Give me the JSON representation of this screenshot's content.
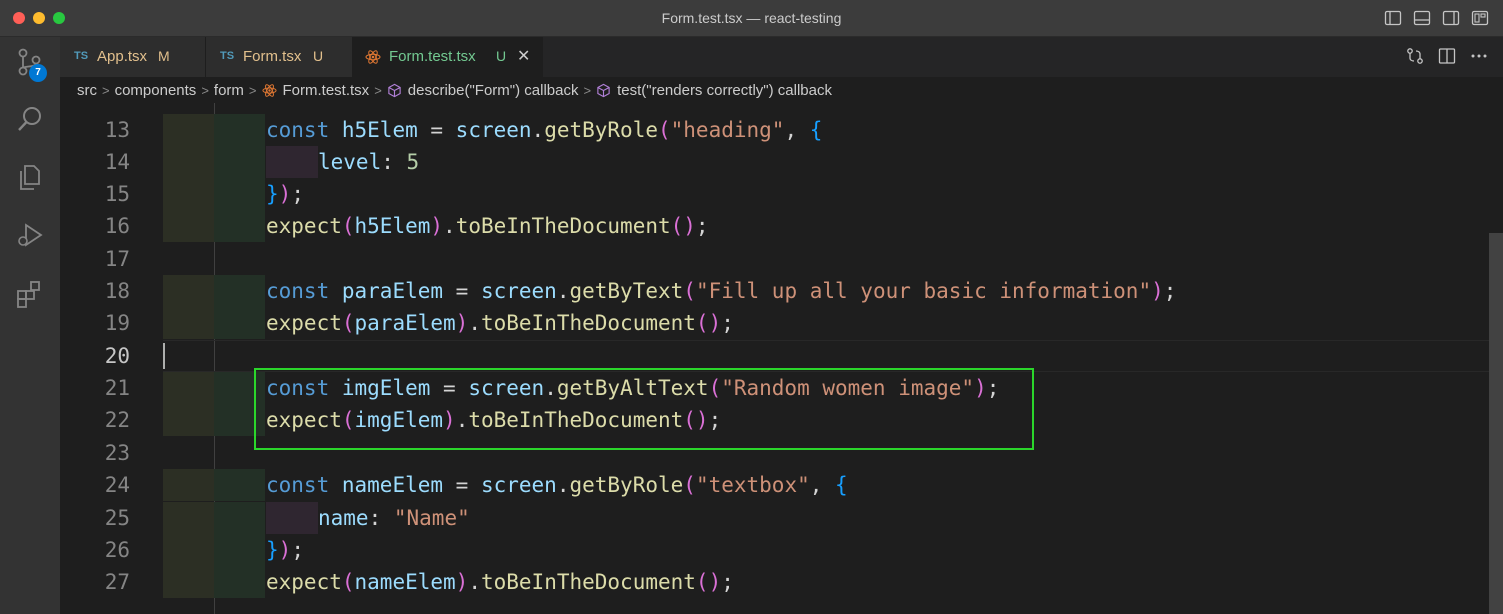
{
  "window": {
    "title": "Form.test.tsx — react-testing"
  },
  "activity": {
    "scm_badge": "7"
  },
  "tabs": [
    {
      "lang": "TS",
      "name": "App.tsx",
      "state": "M"
    },
    {
      "lang": "TS",
      "name": "Form.tsx",
      "state": "U"
    },
    {
      "lang": "",
      "name": "Form.test.tsx",
      "state": "U",
      "close": "✕"
    }
  ],
  "breadcrumb": {
    "items": [
      "src",
      "components",
      "form",
      "Form.test.tsx",
      "describe(\"Form\") callback",
      "test(\"renders correctly\") callback"
    ]
  },
  "editor": {
    "line_numbers": [
      "13",
      "14",
      "15",
      "16",
      "17",
      "18",
      "19",
      "20",
      "21",
      "22",
      "23",
      "24",
      "25",
      "26",
      "27"
    ],
    "current_line": "20"
  },
  "code": {
    "l13": {
      "kw": "const",
      "v1": "h5Elem",
      "eq": " = ",
      "obj": "screen",
      "dot": ".",
      "fn": "getByRole",
      "p1": "(",
      "s1": "\"heading\"",
      "c": ", ",
      "b": "{"
    },
    "l14": {
      "prop": "level",
      "colon": ": ",
      "num": "5"
    },
    "l15": {
      "b": "}",
      "p": ")",
      "semi": ";"
    },
    "l16": {
      "fn": "expect",
      "p1": "(",
      "v": "h5Elem",
      "p2": ")",
      "dot": ".",
      "fn2": "toBeInTheDocument",
      "p3": "()",
      "semi": ";"
    },
    "l18": {
      "kw": "const",
      "v1": "paraElem",
      "eq": " = ",
      "obj": "screen",
      "dot": ".",
      "fn": "getByText",
      "p1": "(",
      "s1": "\"Fill up all your basic information\"",
      "p2": ")",
      "semi": ";"
    },
    "l19": {
      "fn": "expect",
      "p1": "(",
      "v": "paraElem",
      "p2": ")",
      "dot": ".",
      "fn2": "toBeInTheDocument",
      "p3": "()",
      "semi": ";"
    },
    "l21": {
      "kw": "const",
      "v1": "imgElem",
      "eq": " = ",
      "obj": "screen",
      "dot": ".",
      "fn": "getByAltText",
      "p1": "(",
      "s1": "\"Random women image\"",
      "p2": ")",
      "semi": ";"
    },
    "l22": {
      "fn": "expect",
      "p1": "(",
      "v": "imgElem",
      "p2": ")",
      "dot": ".",
      "fn2": "toBeInTheDocument",
      "p3": "()",
      "semi": ";"
    },
    "l24": {
      "kw": "const",
      "v1": "nameElem",
      "eq": " = ",
      "obj": "screen",
      "dot": ".",
      "fn": "getByRole",
      "p1": "(",
      "s1": "\"textbox\"",
      "c": ", ",
      "b": "{"
    },
    "l25": {
      "prop": "name",
      "colon": ": ",
      "str": "\"Name\""
    },
    "l26": {
      "b": "}",
      "p": ")",
      "semi": ";"
    },
    "l27": {
      "fn": "expect",
      "p1": "(",
      "v": "nameElem",
      "p2": ")",
      "dot": ".",
      "fn2": "toBeInTheDocument",
      "p3": "()",
      "semi": ";"
    }
  },
  "colors": {
    "keyword": "#569cd6",
    "variable": "#9cdcfe",
    "function": "#dcdcaa",
    "string": "#ce9178",
    "number": "#b5cea8",
    "highlight_box": "#2bd62b",
    "modified": "#e2c08d",
    "untracked": "#73c991"
  },
  "icons": [
    "source-control-icon",
    "search-icon",
    "explorer-icon",
    "run-debug-icon",
    "extensions-icon",
    "react-icon",
    "split-editor-icon",
    "more-actions-icon",
    "open-changes-icon"
  ]
}
